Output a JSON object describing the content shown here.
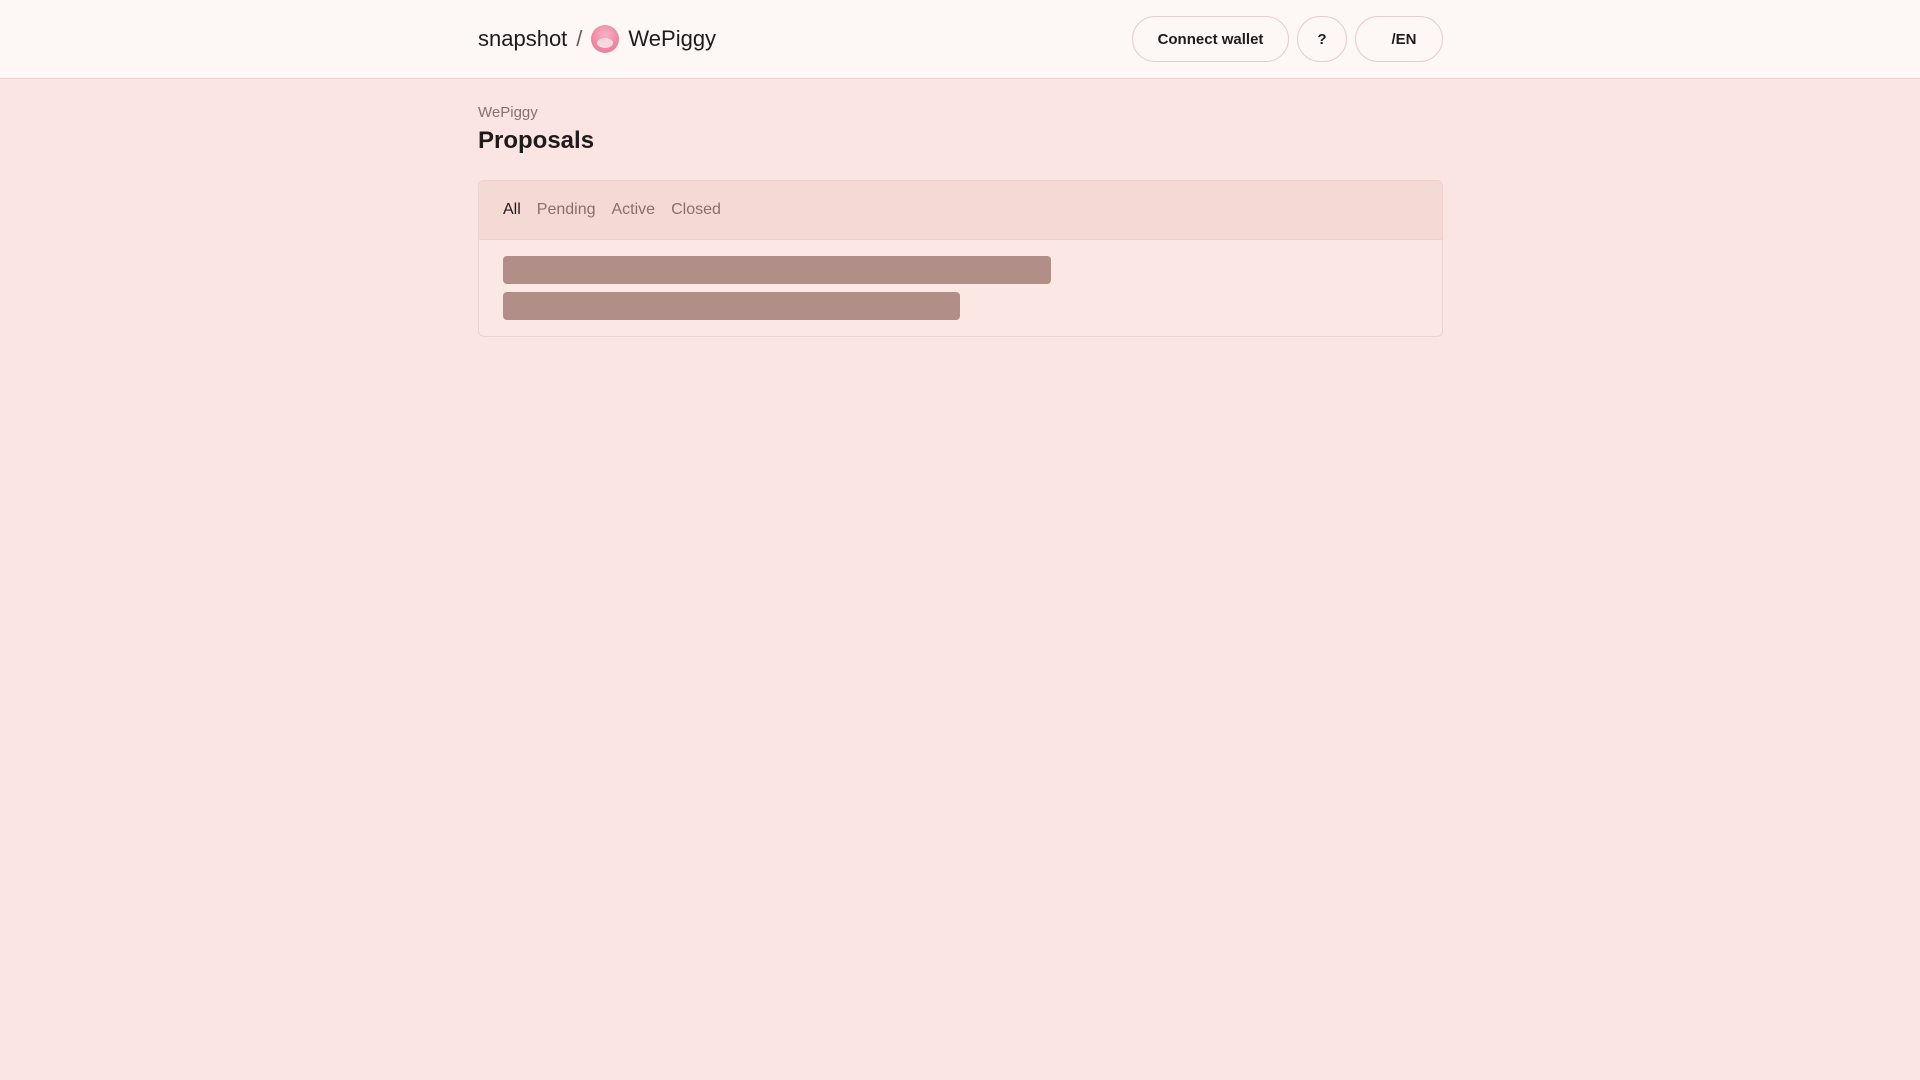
{
  "header": {
    "brand": "snapshot",
    "separator": "/",
    "space_name": "WePiggy",
    "connect_wallet_label": "Connect wallet",
    "help_label": "?",
    "language_label": "/EN"
  },
  "main": {
    "space_label": "WePiggy",
    "title": "Proposals",
    "tabs": [
      {
        "label": "All",
        "active": true
      },
      {
        "label": "Pending",
        "active": false
      },
      {
        "label": "Active",
        "active": false
      },
      {
        "label": "Closed",
        "active": false
      }
    ]
  },
  "colors": {
    "background": "#fbe5e2",
    "header_background": "#fdf7f5",
    "skeleton": "#b28e89",
    "muted_text": "#8a6e6c"
  }
}
